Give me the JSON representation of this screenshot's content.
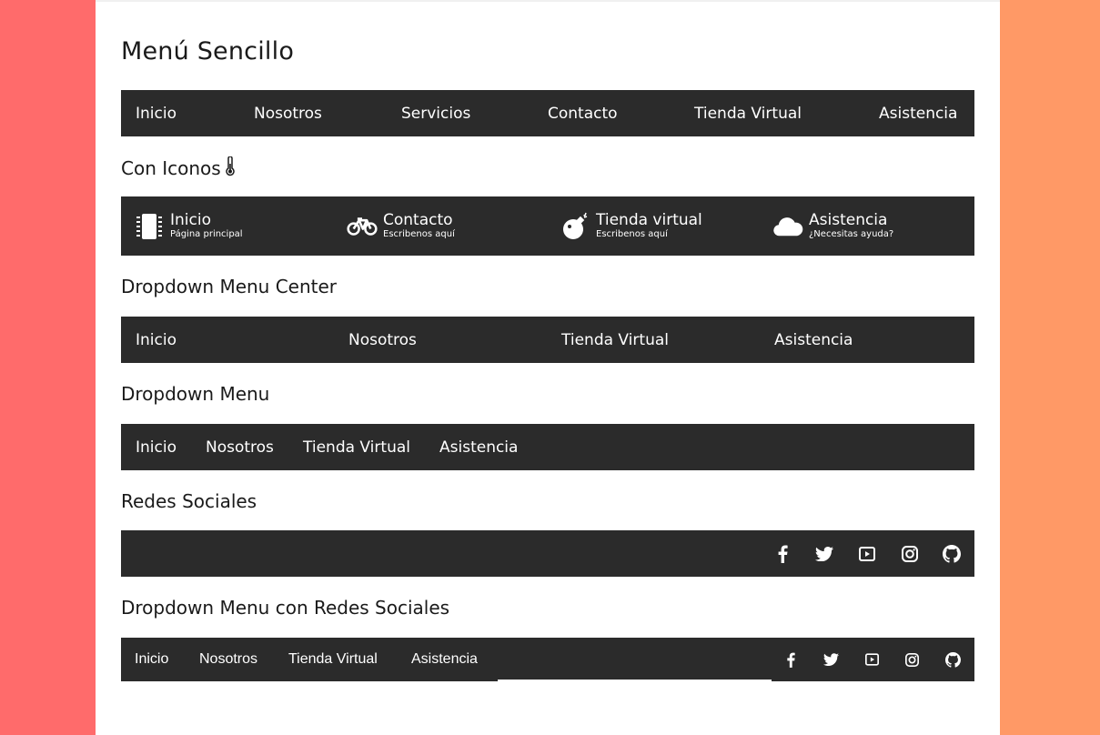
{
  "title": "Menú Sencillo",
  "simple_menu": [
    "Inicio",
    "Nosotros",
    "Servicios",
    "Contacto",
    "Tienda Virtual",
    "Asistencia"
  ],
  "icons_section": {
    "title": "Con Iconos",
    "title_icon": "thermometer-icon",
    "items": [
      {
        "label": "Inicio",
        "sub": "Página principal",
        "icon": "microchip-icon"
      },
      {
        "label": "Contacto",
        "sub": "Escribenos aquí",
        "icon": "bicycle-icon"
      },
      {
        "label": "Tienda virtual",
        "sub": "Escribenos aquí",
        "icon": "bomb-icon"
      },
      {
        "label": "Asistencia",
        "sub": "¿Necesitas ayuda?",
        "icon": "cloud-icon"
      }
    ]
  },
  "dropdown_center": {
    "title": "Dropdown Menu Center",
    "items": [
      "Inicio",
      "Nosotros",
      "Tienda Virtual",
      "Asistencia"
    ]
  },
  "dropdown": {
    "title": "Dropdown Menu",
    "items": [
      "Inicio",
      "Nosotros",
      "Tienda Virtual",
      "Asistencia"
    ]
  },
  "social": {
    "title": "Redes Sociales",
    "icons": [
      "facebook-icon",
      "twitter-icon",
      "youtube-icon",
      "instagram-icon",
      "github-icon"
    ]
  },
  "dropdown_social": {
    "title": "Dropdown Menu con Redes Sociales",
    "items": [
      "Inicio",
      "Nosotros",
      "Tienda Virtual",
      "Asistencia"
    ],
    "icons": [
      "facebook-icon",
      "twitter-icon",
      "youtube-icon",
      "instagram-icon",
      "github-icon"
    ]
  },
  "colors": {
    "left_panel": "#ff6b6b",
    "right_panel": "#ff9966",
    "menu_bar": "#2b2b2b",
    "menu_text": "#ffffff"
  }
}
